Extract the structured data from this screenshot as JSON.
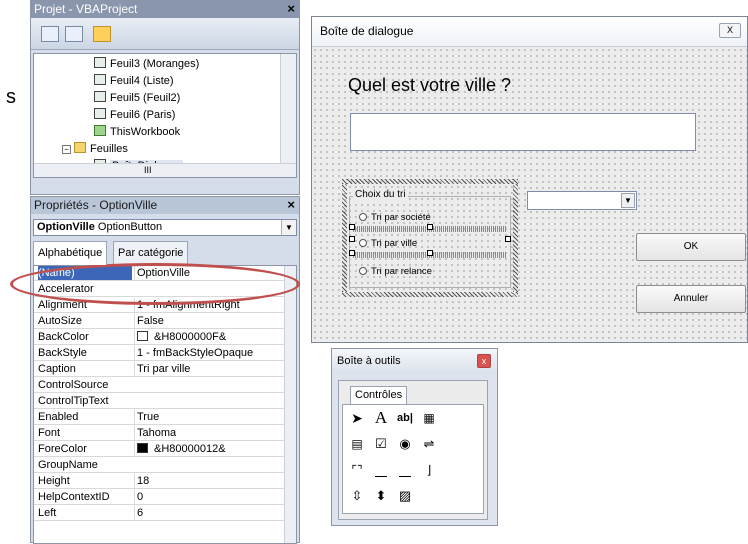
{
  "left_text": "s",
  "project": {
    "title": "Projet - VBAProject",
    "close": "×",
    "tree": [
      {
        "label": "Feuil3 (Moranges)",
        "icon": "sheet-icon"
      },
      {
        "label": "Feuil4 (Liste)",
        "icon": "sheet-icon"
      },
      {
        "label": "Feuil5 (Feuil2)",
        "icon": "sheet-icon"
      },
      {
        "label": "Feuil6 (Paris)",
        "icon": "sheet-icon"
      },
      {
        "label": "ThisWorkbook",
        "icon": "workbook-icon"
      },
      {
        "label": "Feuilles",
        "icon": "folder-icon"
      },
      {
        "label": "BoîteDialogue",
        "icon": "userform-icon"
      }
    ],
    "hscroll_dots": "III"
  },
  "properties": {
    "title": "Propriétés - OptionVille",
    "close": "×",
    "object_name": "OptionVille",
    "object_type": "OptionButton",
    "tab_alpha": "Alphabétique",
    "tab_category": "Par catégorie",
    "rows": [
      {
        "key": "(Name)",
        "value": "OptionVille"
      },
      {
        "key": "Accelerator",
        "value": ""
      },
      {
        "key": "Alignment",
        "value": "1 - fmAlignmentRight"
      },
      {
        "key": "AutoSize",
        "value": "False"
      },
      {
        "key": "BackColor",
        "value": "&H8000000F&"
      },
      {
        "key": "BackStyle",
        "value": "1 - fmBackStyleOpaque"
      },
      {
        "key": "Caption",
        "value": "Tri par ville"
      },
      {
        "key": "ControlSource",
        "value": ""
      },
      {
        "key": "ControlTipText",
        "value": ""
      },
      {
        "key": "Enabled",
        "value": "True"
      },
      {
        "key": "Font",
        "value": "Tahoma"
      },
      {
        "key": "ForeColor",
        "value": "&H80000012&"
      },
      {
        "key": "GroupName",
        "value": ""
      },
      {
        "key": "Height",
        "value": "18"
      },
      {
        "key": "HelpContextID",
        "value": "0"
      },
      {
        "key": "Left",
        "value": "6"
      }
    ],
    "backcolor_swatch": "#ffffff",
    "forecolor_swatch": "#000000"
  },
  "form": {
    "title": "Boîte de dialogue",
    "close": "X",
    "question": "Quel est votre ville ?",
    "frame_caption": "Choix du tri",
    "options": [
      "Tri par société",
      "Tri par ville",
      "Tri par relance"
    ],
    "ok": "OK",
    "cancel": "Annuler"
  },
  "toolbox": {
    "title": "Boîte à outils",
    "close": "x",
    "tab": "Contrôles"
  },
  "colors": {
    "highlight": "#c0504d",
    "selection": "#3d66b8"
  }
}
